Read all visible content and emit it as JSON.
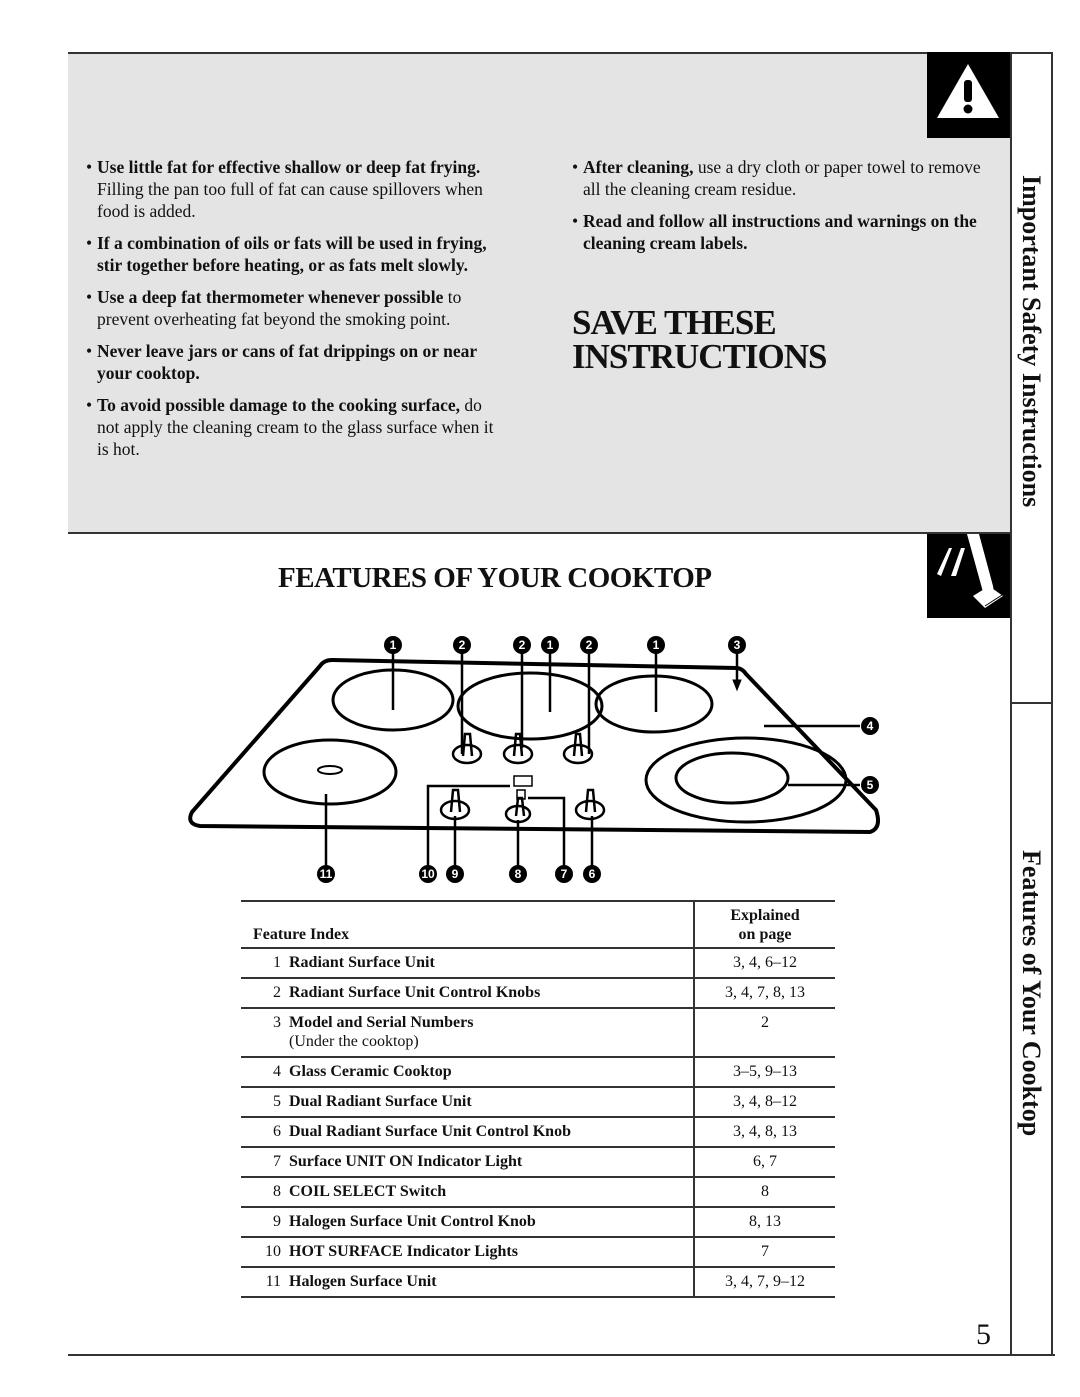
{
  "safety": {
    "left_bullets": [
      {
        "bold": "Use little fat for effective shallow or deep fat frying.",
        "text": " Filling the pan too full of fat can cause spillovers when food is added."
      },
      {
        "bold": "If a combination of oils or fats will be used in frying, stir together before heating, or as fats melt slowly.",
        "text": ""
      },
      {
        "bold": "Use a deep fat thermometer whenever possible",
        "text": " to prevent overheating fat beyond the smoking point."
      },
      {
        "bold": "Never leave jars or cans of fat drippings on or near your cooktop.",
        "text": ""
      },
      {
        "bold": "To avoid possible damage to the cooking surface,",
        "text": " do not apply the cleaning cream to the glass surface when it is hot."
      }
    ],
    "right_bullets": [
      {
        "bold": "After cleaning,",
        "text": " use a dry cloth or paper towel to remove all the cleaning cream residue."
      },
      {
        "bold": "Read and follow all instructions and warnings on the cleaning cream labels.",
        "text": ""
      }
    ],
    "save_title_line1": "SAVE THESE",
    "save_title_line2": "INSTRUCTIONS"
  },
  "sidebar": {
    "tab1": "Important Safety Instructions",
    "tab2": "Features of Your Cooktop",
    "icons": [
      "warning-icon",
      "hand-pointing-icon"
    ]
  },
  "features": {
    "title": "FEATURES OF YOUR COOKTOP",
    "diagram_callouts": {
      "top": [
        "1",
        "2",
        "2",
        "1",
        "2",
        "1",
        "3"
      ],
      "right": [
        "4",
        "5"
      ],
      "bottom": [
        "11",
        "10",
        "9",
        "8",
        "7",
        "6"
      ]
    },
    "table": {
      "header_label": "Feature Index",
      "header_page_line1": "Explained",
      "header_page_line2": "on page",
      "rows": [
        {
          "num": "1",
          "name": "Radiant Surface Unit",
          "sub": "",
          "pages": "3, 4, 6–12"
        },
        {
          "num": "2",
          "name": "Radiant Surface Unit Control Knobs",
          "sub": "",
          "pages": "3, 4, 7, 8, 13"
        },
        {
          "num": "3",
          "name": "Model and Serial Numbers",
          "sub": "(Under the cooktop)",
          "pages": "2"
        },
        {
          "num": "4",
          "name": "Glass Ceramic Cooktop",
          "sub": "",
          "pages": "3–5, 9–13"
        },
        {
          "num": "5",
          "name": "Dual Radiant Surface Unit",
          "sub": "",
          "pages": "3, 4, 8–12"
        },
        {
          "num": "6",
          "name": "Dual Radiant Surface Unit Control Knob",
          "sub": "",
          "pages": "3, 4, 8, 13"
        },
        {
          "num": "7",
          "name": "Surface UNIT ON Indicator Light",
          "sub": "",
          "pages": "6, 7"
        },
        {
          "num": "8",
          "name": "COIL SELECT Switch",
          "sub": "",
          "pages": "8"
        },
        {
          "num": "9",
          "name": "Halogen Surface Unit Control Knob",
          "sub": "",
          "pages": "8, 13"
        },
        {
          "num": "10",
          "name": "HOT SURFACE Indicator Lights",
          "sub": "",
          "pages": "7"
        },
        {
          "num": "11",
          "name": "Halogen Surface Unit",
          "sub": "",
          "pages": "3, 4, 7, 9–12"
        }
      ]
    }
  },
  "page_number": "5"
}
